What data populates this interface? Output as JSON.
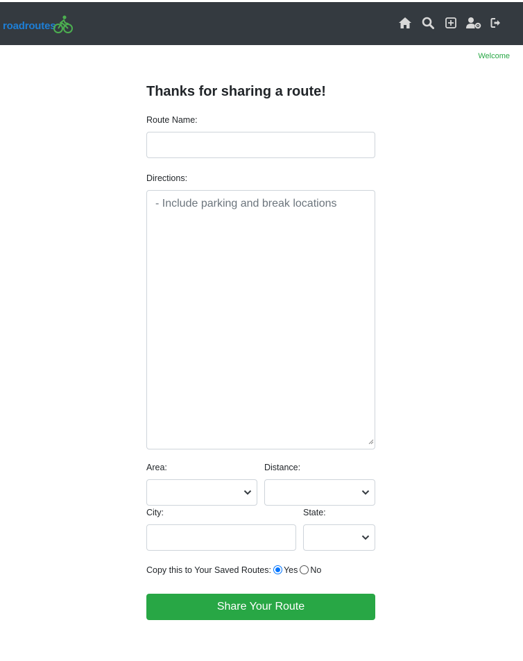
{
  "navbar": {
    "brand": "roadroutes",
    "icons": [
      "home-icon",
      "search-icon",
      "add-route-icon",
      "user-settings-icon",
      "logout-icon"
    ]
  },
  "welcome": "Welcome",
  "form": {
    "title": "Thanks for sharing a route!",
    "route_name_label": "Route Name:",
    "route_name_value": "",
    "directions_label": "Directions:",
    "directions_placeholder": "- Include parking and break locations",
    "area_label": "Area:",
    "area_value": "",
    "distance_label": "Distance:",
    "distance_value": "",
    "city_label": "City:",
    "city_value": "",
    "state_label": "State:",
    "state_value": "",
    "copy_label": "Copy this to Your Saved Routes:",
    "copy_options": [
      "Yes",
      "No"
    ],
    "copy_selected": "Yes",
    "submit_label": "Share Your Route"
  },
  "colors": {
    "navbar": "#343a40",
    "brand": "#1e7fd6",
    "accent": "#28a745"
  }
}
